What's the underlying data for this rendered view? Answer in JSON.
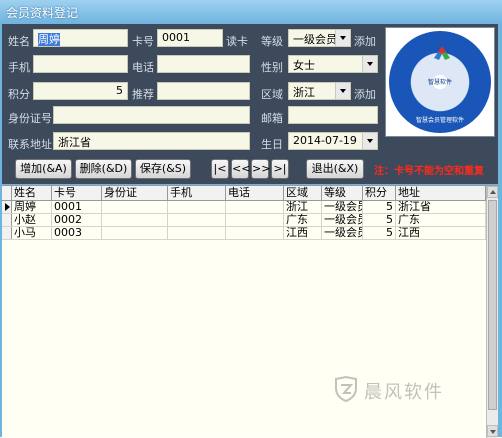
{
  "window": {
    "title": "会员资料登记"
  },
  "form": {
    "name": {
      "label": "姓名",
      "value": "周婷"
    },
    "card": {
      "label": "卡号",
      "value": "0001",
      "read_label": "读卡"
    },
    "level": {
      "label": "等级",
      "value": "一级会员",
      "add_label": "添加"
    },
    "phone": {
      "label": "手机",
      "value": ""
    },
    "tel": {
      "label": "电话",
      "value": ""
    },
    "gender": {
      "label": "性别",
      "value": "女士"
    },
    "points": {
      "label": "积分",
      "value": "5"
    },
    "referrer": {
      "label": "推荐",
      "value": ""
    },
    "region": {
      "label": "区域",
      "value": "浙江",
      "add_label": "添加"
    },
    "id_number": {
      "label": "身份证号",
      "value": ""
    },
    "email": {
      "label": "邮箱",
      "value": ""
    },
    "address": {
      "label": "联系地址",
      "value": "浙江省"
    },
    "birthday": {
      "label": "生日",
      "value": "2014-07-19"
    }
  },
  "logo": {
    "brand": "智慧软件",
    "text": "智慧会员管理软件"
  },
  "buttons": {
    "add": "增加(&A)",
    "delete": "删除(&D)",
    "save": "保存(&S)",
    "first": "|<",
    "prev": "<<",
    "next": ">>",
    "last": ">|",
    "exit": "退出(&X)"
  },
  "warning": "注：卡号不能为空和重复",
  "table": {
    "columns": [
      "姓名",
      "卡号",
      "身份证",
      "手机",
      "电话",
      "区域",
      "等级",
      "积分",
      "地址"
    ],
    "rows": [
      {
        "name": "周婷",
        "card": "0001",
        "id": "",
        "mobile": "",
        "phone": "",
        "region": "浙江",
        "level": "一级会员",
        "points": "5",
        "address": "浙江省"
      },
      {
        "name": "小赵",
        "card": "0002",
        "id": "",
        "mobile": "",
        "phone": "",
        "region": "广东",
        "level": "一级会员",
        "points": "5",
        "address": "广东"
      },
      {
        "name": "小马",
        "card": "0003",
        "id": "",
        "mobile": "",
        "phone": "",
        "region": "江西",
        "level": "一级会员",
        "points": "5",
        "address": "江西"
      }
    ]
  },
  "watermark": "晨风软件",
  "colors": {
    "form_bg": "#3c4a5c",
    "warning": "#ff2a1a",
    "grid_bg": "#fffff4"
  }
}
